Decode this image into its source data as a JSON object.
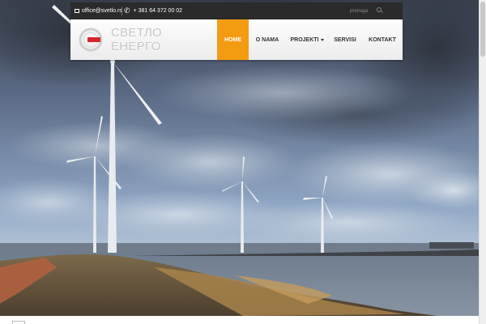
{
  "topbar": {
    "email": "office@svetlo.rs",
    "phone": "+ 381 64 372 00 02",
    "search_placeholder": "pretraga",
    "icons": {
      "email": "envelope-icon",
      "phone": "phone-icon",
      "search": "search-icon"
    }
  },
  "header": {
    "logo_text": "СВЕТЛО ЕНЕРГО"
  },
  "nav": {
    "items": [
      {
        "label": "HOME",
        "active": true
      },
      {
        "label": "O NAMA",
        "active": false
      },
      {
        "label": "PROJEKTI",
        "active": false,
        "has_dropdown": true
      },
      {
        "label": "SERVISI",
        "active": false
      },
      {
        "label": "KONTAKT",
        "active": false
      }
    ]
  },
  "colors": {
    "accent": "#f39c12",
    "topbar_bg": "#2b2b2b",
    "logo_red": "#d6282f",
    "logo_text": "#c7c7c7"
  }
}
